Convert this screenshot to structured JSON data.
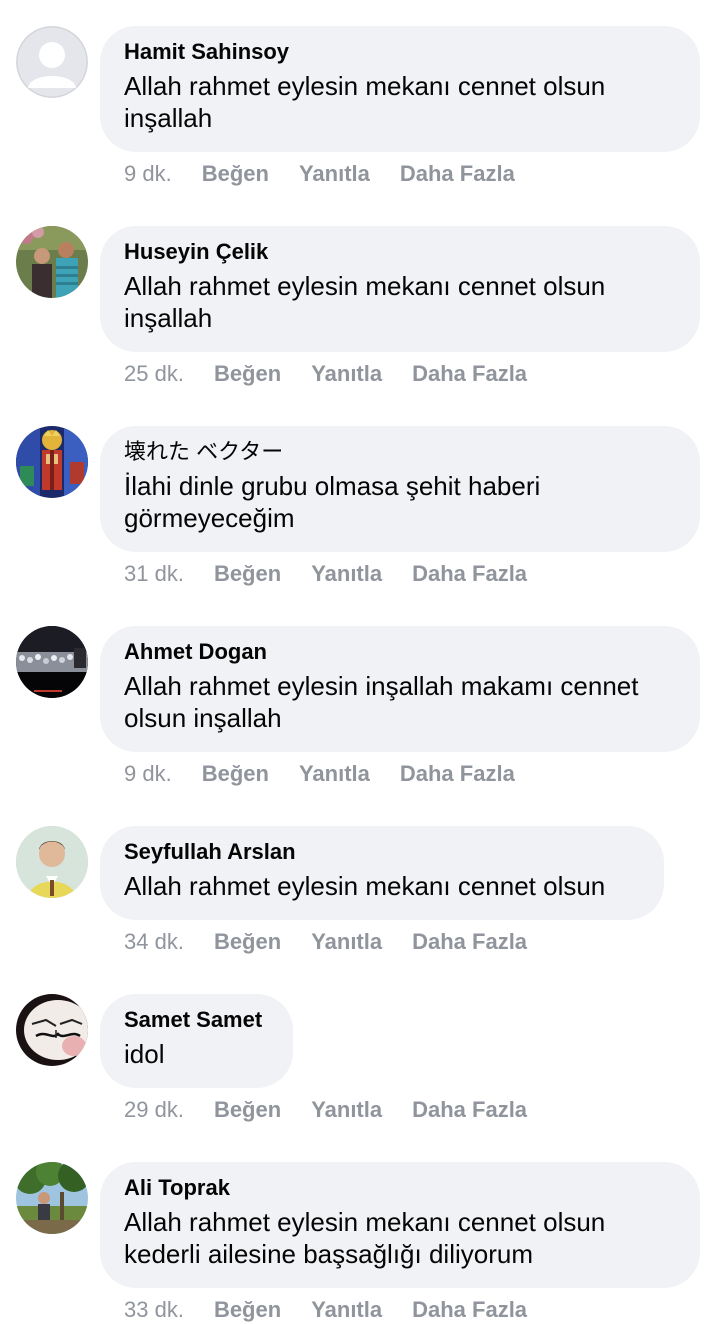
{
  "comments": [
    {
      "author": "Hamit Sahinsoy",
      "text": "Allah rahmet eylesin mekanı cennet olsun inşallah",
      "time": "9 dk.",
      "like": "Beğen",
      "reply": "Yanıtla",
      "more": "Daha Fazla",
      "avatar_icon": "default-profile-icon"
    },
    {
      "author": "Huseyin Çelik",
      "text": "Allah rahmet eylesin mekanı cennet olsun inşallah",
      "time": "25 dk.",
      "like": "Beğen",
      "reply": "Yanıtla",
      "more": "Daha Fazla",
      "avatar_icon": "two-people-photo"
    },
    {
      "author": "壊れた ベクター",
      "text": "İlahi dinle grubu olmasa şehit haberi görmeyeceğim",
      "time": "31 dk.",
      "like": "Beğen",
      "reply": "Yanıtla",
      "more": "Daha Fazla",
      "avatar_icon": "stained-glass-photo"
    },
    {
      "author": "Ahmet Dogan",
      "text": "Allah rahmet eylesin inşallah makamı cennet olsun inşallah",
      "time": "9 dk.",
      "like": "Beğen",
      "reply": "Yanıtla",
      "more": "Daha Fazla",
      "avatar_icon": "night-crowd-photo"
    },
    {
      "author": "Seyfullah Arslan",
      "text": "Allah rahmet eylesin mekanı cennet olsun",
      "time": "34 dk.",
      "like": "Beğen",
      "reply": "Yanıtla",
      "more": "Daha Fazla",
      "avatar_icon": "portrait-photo"
    },
    {
      "author": "Samet Samet",
      "text": "idol",
      "time": "29 dk.",
      "like": "Beğen",
      "reply": "Yanıtla",
      "more": "Daha Fazla",
      "avatar_icon": "mustache-drawing-photo"
    },
    {
      "author": "Ali Toprak",
      "text": "Allah rahmet eylesin mekanı cennet olsun kederli ailesine başsağlığı diliyorum",
      "time": "33 dk.",
      "like": "Beğen",
      "reply": "Yanıtla",
      "more": "Daha Fazla",
      "avatar_icon": "outdoor-trees-photo"
    }
  ],
  "colors": {
    "bubble": "#f0f2f5",
    "text": "#050505",
    "meta": "#90949c"
  }
}
